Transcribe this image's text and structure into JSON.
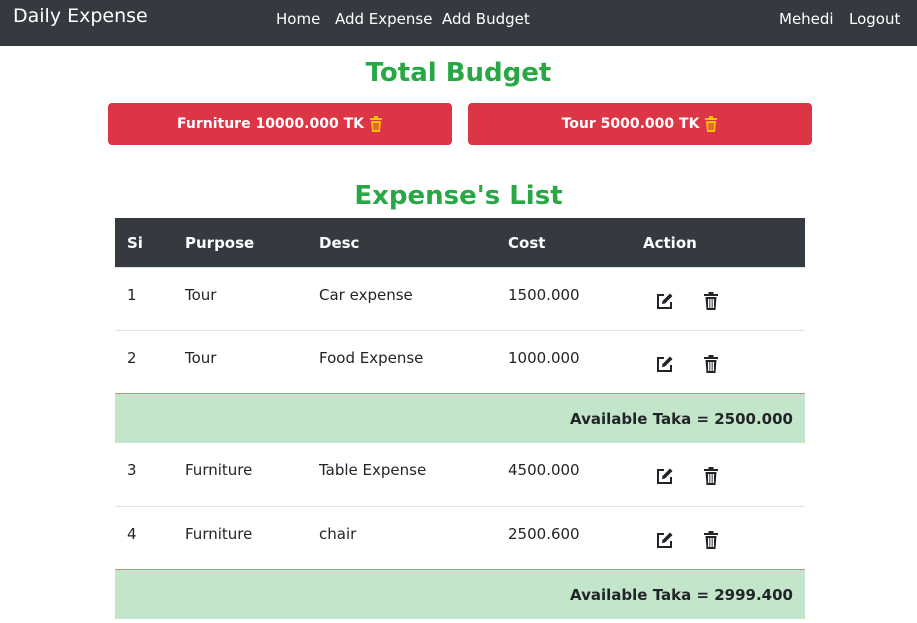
{
  "nav": {
    "brand": "Daily Expense",
    "links": [
      "Home",
      "Add Expense",
      "Add Budget"
    ],
    "user": "Mehedi",
    "logout": "Logout"
  },
  "budget": {
    "title": "Total Budget",
    "items": [
      {
        "label": "Furniture 10000.000 TK"
      },
      {
        "label": "Tour 5000.000 TK"
      }
    ],
    "icon": "trash-icon",
    "icon_color": "#ffc107",
    "button_color": "#dc3545"
  },
  "expenses": {
    "title": "Expense's List",
    "columns": [
      "Si",
      "Purpose",
      "Desc",
      "Cost",
      "Action"
    ],
    "rows": [
      {
        "si": "1",
        "purpose": "Tour",
        "desc": "Car expense",
        "cost": "1500.000"
      },
      {
        "si": "2",
        "purpose": "Tour",
        "desc": "Food Expense",
        "cost": "1000.000"
      },
      {
        "si": "3",
        "purpose": "Furniture",
        "desc": "Table Expense",
        "cost": "4500.000"
      },
      {
        "si": "4",
        "purpose": "Furniture",
        "desc": "chair",
        "cost": "2500.600"
      }
    ],
    "summaries": [
      "Available Taka = 2500.000",
      "Available Taka = 2999.400"
    ],
    "action_icons": [
      "edit-icon",
      "trash-icon"
    ]
  },
  "colors": {
    "navbar": "#343a40",
    "title_green": "#28a745",
    "summary_bg": "#c3e6cb"
  }
}
